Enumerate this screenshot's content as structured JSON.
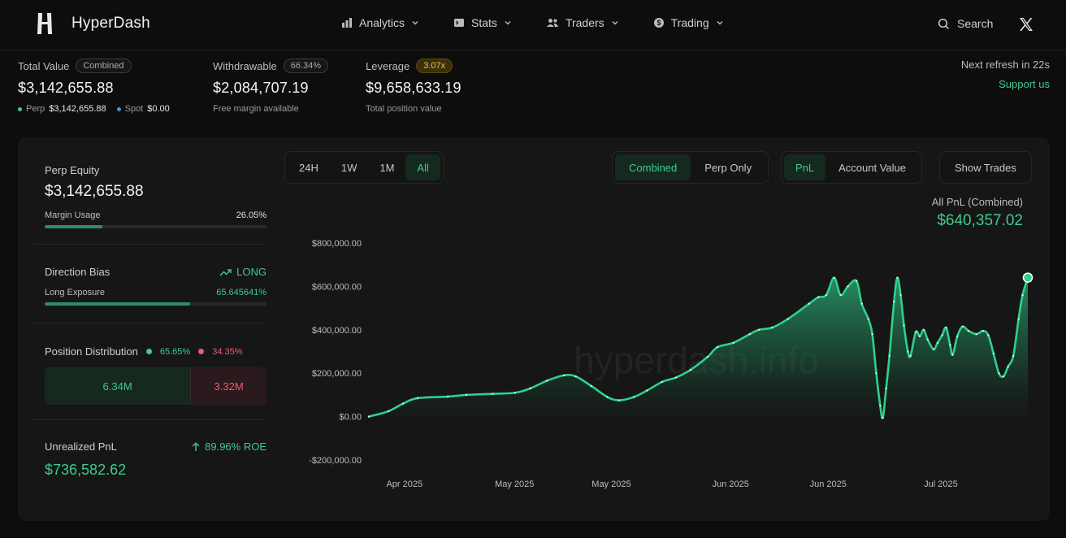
{
  "header": {
    "brand": "HyperDash",
    "nav": [
      {
        "label": "Analytics",
        "icon": "bar-chart-icon"
      },
      {
        "label": "Stats",
        "icon": "terminal-icon"
      },
      {
        "label": "Traders",
        "icon": "users-icon"
      },
      {
        "label": "Trading",
        "icon": "dollar-circle-icon"
      }
    ],
    "search_label": "Search"
  },
  "stats": {
    "total_value": {
      "label": "Total Value",
      "badge": "Combined",
      "value": "$3,142,655.88",
      "perp_label": "Perp",
      "perp_value": "$3,142,655.88",
      "spot_label": "Spot",
      "spot_value": "$0.00"
    },
    "withdrawable": {
      "label": "Withdrawable",
      "badge": "66.34%",
      "value": "$2,084,707.19",
      "sub": "Free margin available"
    },
    "leverage": {
      "label": "Leverage",
      "badge": "3.07x",
      "value": "$9,658,633.19",
      "sub": "Total position value"
    },
    "refresh": "Next refresh in 22s",
    "support": "Support us"
  },
  "left": {
    "perp_equity_label": "Perp Equity",
    "perp_equity_value": "$3,142,655.88",
    "margin_usage_label": "Margin Usage",
    "margin_usage_value": "26.05%",
    "margin_usage_fraction": 0.2605,
    "direction_bias_label": "Direction Bias",
    "direction_bias_value": "LONG",
    "long_exposure_label": "Long Exposure",
    "long_exposure_value": "65.645641%",
    "long_exposure_fraction": 0.6565,
    "position_distribution_label": "Position Distribution",
    "long_pct": "65.65%",
    "short_pct": "34.35%",
    "long_amount": "6.34M",
    "short_amount": "3.32M",
    "long_fraction": 0.6565,
    "unrealized_pnl_label": "Unrealized PnL",
    "roe": "89.96% ROE",
    "unrealized_pnl_value": "$736,582.62"
  },
  "controls": {
    "timeframes": [
      "24H",
      "1W",
      "1M",
      "All"
    ],
    "active_timeframe": "All",
    "scopes": [
      "Combined",
      "Perp Only"
    ],
    "active_scope": "Combined",
    "metrics": [
      "PnL",
      "Account Value"
    ],
    "active_metric": "PnL",
    "show_trades": "Show Trades"
  },
  "pnl_summary": {
    "title": "All PnL (Combined)",
    "value": "$640,357.02"
  },
  "colors": {
    "accent": "#3ecb8e",
    "negative": "#ef5a72",
    "leverage": "#f0c542",
    "spot": "#4d8fd6"
  },
  "chart_data": {
    "type": "area",
    "watermark": "hyperdash.info",
    "y_ticks": [
      "$800,000.00",
      "$600,000.00",
      "$400,000.00",
      "$200,000.00",
      "$0.00",
      "-$200,000.00"
    ],
    "y_tick_values": [
      800000,
      600000,
      400000,
      200000,
      0,
      -200000
    ],
    "ylim": [
      -200000,
      800000
    ],
    "x_ticks": [
      {
        "label": "Apr 2025",
        "t": 0.054
      },
      {
        "label": "May 2025",
        "t": 0.221
      },
      {
        "label": "May 2025",
        "t": 0.368
      },
      {
        "label": "Jun 2025",
        "t": 0.549
      },
      {
        "label": "Jun 2025",
        "t": 0.697
      },
      {
        "label": "Jul 2025",
        "t": 0.868
      }
    ],
    "series": [
      {
        "values": [
          [
            0.0,
            0
          ],
          [
            0.03,
            25000
          ],
          [
            0.052,
            60000
          ],
          [
            0.074,
            85000
          ],
          [
            0.12,
            92000
          ],
          [
            0.148,
            100000
          ],
          [
            0.188,
            105000
          ],
          [
            0.222,
            110000
          ],
          [
            0.245,
            130000
          ],
          [
            0.27,
            165000
          ],
          [
            0.296,
            190000
          ],
          [
            0.314,
            185000
          ],
          [
            0.338,
            140000
          ],
          [
            0.362,
            90000
          ],
          [
            0.38,
            75000
          ],
          [
            0.402,
            90000
          ],
          [
            0.422,
            120000
          ],
          [
            0.445,
            160000
          ],
          [
            0.466,
            180000
          ],
          [
            0.488,
            215000
          ],
          [
            0.514,
            275000
          ],
          [
            0.529,
            320000
          ],
          [
            0.553,
            340000
          ],
          [
            0.578,
            380000
          ],
          [
            0.592,
            400000
          ],
          [
            0.612,
            410000
          ],
          [
            0.636,
            450000
          ],
          [
            0.668,
            520000
          ],
          [
            0.682,
            550000
          ],
          [
            0.694,
            560000
          ],
          [
            0.706,
            640000
          ],
          [
            0.716,
            560000
          ],
          [
            0.727,
            600000
          ],
          [
            0.74,
            625000
          ],
          [
            0.748,
            520000
          ],
          [
            0.758,
            450000
          ],
          [
            0.764,
            380000
          ],
          [
            0.77,
            200000
          ],
          [
            0.776,
            50000
          ],
          [
            0.78,
            -5000
          ],
          [
            0.785,
            130000
          ],
          [
            0.79,
            280000
          ],
          [
            0.797,
            530000
          ],
          [
            0.802,
            640000
          ],
          [
            0.807,
            560000
          ],
          [
            0.812,
            420000
          ],
          [
            0.818,
            300000
          ],
          [
            0.822,
            280000
          ],
          [
            0.83,
            390000
          ],
          [
            0.836,
            370000
          ],
          [
            0.842,
            400000
          ],
          [
            0.848,
            355000
          ],
          [
            0.857,
            310000
          ],
          [
            0.863,
            340000
          ],
          [
            0.87,
            375000
          ],
          [
            0.876,
            410000
          ],
          [
            0.882,
            330000
          ],
          [
            0.886,
            285000
          ],
          [
            0.893,
            370000
          ],
          [
            0.901,
            415000
          ],
          [
            0.91,
            395000
          ],
          [
            0.922,
            380000
          ],
          [
            0.932,
            395000
          ],
          [
            0.94,
            375000
          ],
          [
            0.948,
            290000
          ],
          [
            0.956,
            200000
          ],
          [
            0.963,
            185000
          ],
          [
            0.97,
            230000
          ],
          [
            0.978,
            280000
          ],
          [
            0.986,
            450000
          ],
          [
            0.992,
            560000
          ],
          [
            1.0,
            640357
          ]
        ]
      }
    ]
  }
}
